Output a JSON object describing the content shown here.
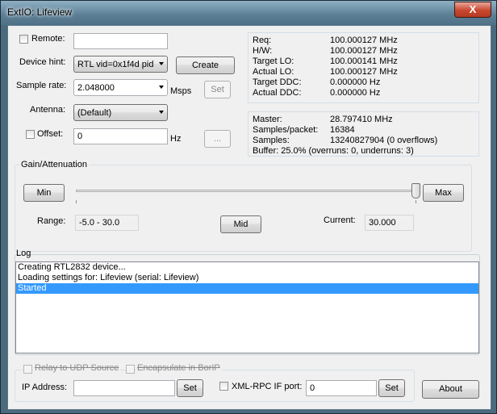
{
  "window": {
    "title": "ExtIO: Lifeview",
    "close_glyph": "X"
  },
  "remote": {
    "label": "Remote:",
    "value": ""
  },
  "device_hint": {
    "label": "Device hint:",
    "selected": "RTL vid=0x1f4d pid",
    "create_label": "Create"
  },
  "sample_rate": {
    "label": "Sample rate:",
    "selected": "2.048000",
    "unit": "Msps",
    "set_label": "Set"
  },
  "antenna": {
    "label": "Antenna:",
    "selected": "(Default)"
  },
  "offset": {
    "label": "Offset:",
    "value": "0",
    "unit": "Hz",
    "browse_label": "..."
  },
  "freq_panel": {
    "rows": [
      {
        "k": "Req:",
        "v": "100.000127 MHz"
      },
      {
        "k": "H/W:",
        "v": "100.000127 MHz"
      },
      {
        "k": "Target LO:",
        "v": "100.000141 MHz"
      },
      {
        "k": "Actual LO:",
        "v": "100.000127 MHz"
      },
      {
        "k": "Target DDC:",
        "v": "0.000000 Hz"
      },
      {
        "k": "Actual DDC:",
        "v": "0.000000 Hz"
      }
    ]
  },
  "stats_panel": {
    "master": {
      "k": "Master:",
      "v": "28.797410 MHz"
    },
    "samples_packet": {
      "k": "Samples/packet:",
      "v": "16384"
    },
    "samples": {
      "k": "Samples:",
      "v": "13240827904 (0 overflows)"
    },
    "buffer": "Buffer: 25.0% (overruns: 0, underruns: 3)"
  },
  "gain": {
    "caption": "Gain/Attenuation",
    "min_label": "Min",
    "max_label": "Max",
    "mid_label": "Mid",
    "range_label": "Range:",
    "range_value": "-5.0 - 30.0",
    "current_label": "Current:",
    "current_value": "30.000",
    "slider_fraction": 1.0
  },
  "log": {
    "caption": "Log",
    "lines": [
      "Creating RTL2832 device...",
      "Loading settings for: Lifeview (serial: Lifeview)",
      "Started"
    ],
    "selected_index": 2
  },
  "udp": {
    "relay_label": "Relay to UDP Source",
    "encap_label": "Encapsulate in BorIP",
    "ip_label": "IP Address:",
    "ip_value": "",
    "set_label": "Set"
  },
  "xmlrpc": {
    "label": "XML-RPC IF port:",
    "value": "0",
    "set_label": "Set"
  },
  "about_label": "About"
}
